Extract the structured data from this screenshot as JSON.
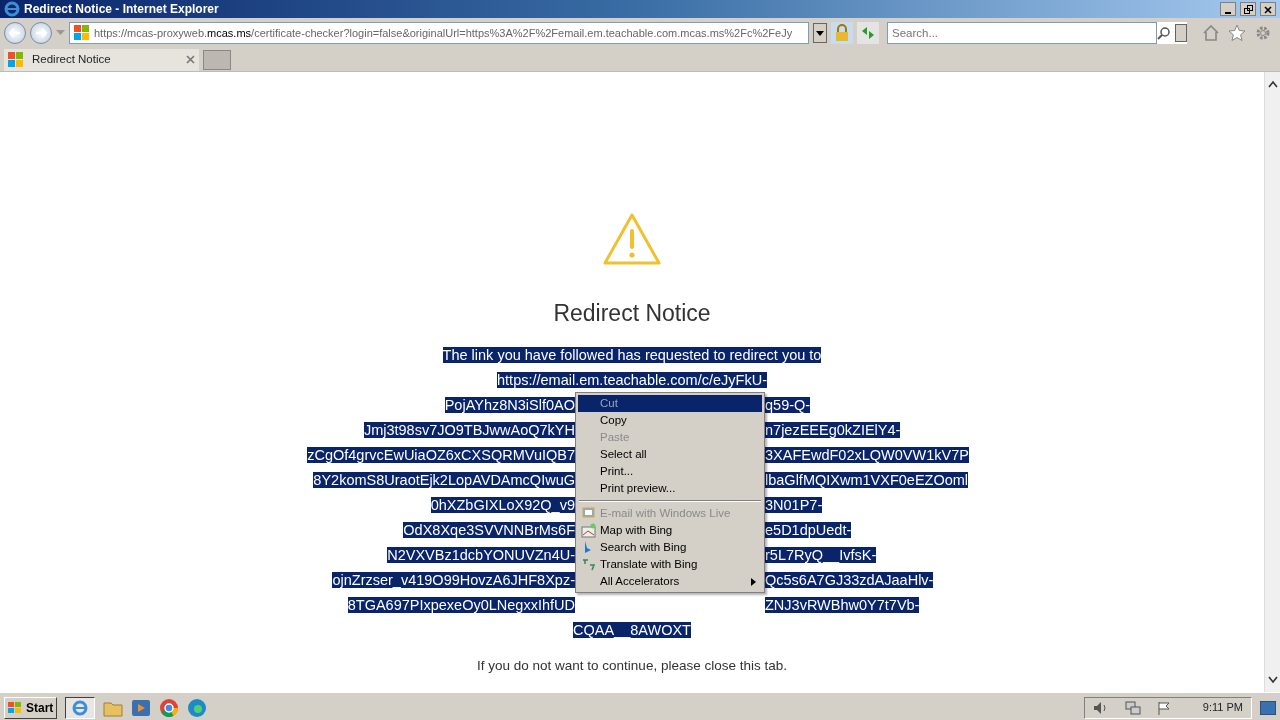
{
  "window": {
    "title": "Redirect Notice - Internet Explorer"
  },
  "address_bar": {
    "scheme": "https://mcas-proxyweb.",
    "domain": "mcas.ms",
    "path": "/certificate-checker?login=false&originalUrl=https%3A%2F%2Femail.em.teachable.com.mcas.ms%2Fc%2FeJy"
  },
  "search": {
    "placeholder": "Search..."
  },
  "tabs": [
    {
      "label": "Redirect Notice",
      "selected": true
    }
  ],
  "page": {
    "heading": "Redirect Notice",
    "lines": [
      {
        "left": "The link you have followed has requested to redirect you to"
      },
      {
        "left": "https://email.em.teachable.com/c/eJyFkU-"
      },
      {
        "left": "PojAYhz8N3iSlf0AO",
        "right": "q59-Q-"
      },
      {
        "left": "Jmj3t98sv7JO9TBJwwAoQ7kYH",
        "right": "n7jezEEEg0kZIElY4-"
      },
      {
        "left": "zCgOf4grvcEwUiaOZ6xCXSQRMVuIQB7",
        "right": "3XAFEwdF02xLQW0VW1kV7P"
      },
      {
        "left": "8Y2komS8UraotEjk2LopAVDAmcQIwuG",
        "right": "lbaGlfMQIXwm1VXF0eEZOoml"
      },
      {
        "left": "0hXZbGIXLoX92Q_v9",
        "right": "3N01P7-"
      },
      {
        "left": "OdX8Xqe3SVVNNBrMs6F",
        "right": "e5D1dpUedt-"
      },
      {
        "left": "N2VXVBz1dcbYONUVZn4U-",
        "right": "r5L7RyQ__IvfsK-"
      },
      {
        "left": "ojnZrzser_v419O99HovzA6JHF8Xpz-",
        "right": "Qc5s6A7GJ33zdAJaaHlv-"
      },
      {
        "left": "8TGA697PIxpexeOy0LNegxxIhfUD",
        "right": "ZNJ3vRWBhw0Y7t7Vb-"
      },
      {
        "left": "CQAA__8AWOXT"
      }
    ],
    "footer": "If you do not want to continue, please close this tab."
  },
  "context_menu": {
    "groups": [
      [
        {
          "label": "Cut",
          "disabled": true,
          "selected": true
        },
        {
          "label": "Copy",
          "disabled": false,
          "selected": false
        },
        {
          "label": "Paste",
          "disabled": true,
          "selected": false
        },
        {
          "label": "Select all",
          "disabled": false,
          "selected": false
        },
        {
          "label": "Print...",
          "disabled": false,
          "selected": false
        },
        {
          "label": "Print preview...",
          "disabled": false,
          "selected": false
        }
      ],
      [
        {
          "label": "E-mail with Windows Live",
          "disabled": true,
          "selected": false
        },
        {
          "label": "Map with Bing",
          "disabled": false,
          "selected": false
        },
        {
          "label": "Search with Bing",
          "disabled": false,
          "selected": false
        },
        {
          "label": "Translate with Bing",
          "disabled": false,
          "selected": false
        },
        {
          "label": "All Accelerators",
          "disabled": false,
          "selected": false,
          "submenu": true
        }
      ]
    ]
  },
  "taskbar": {
    "start": "Start",
    "clock": "9:11 PM"
  }
}
